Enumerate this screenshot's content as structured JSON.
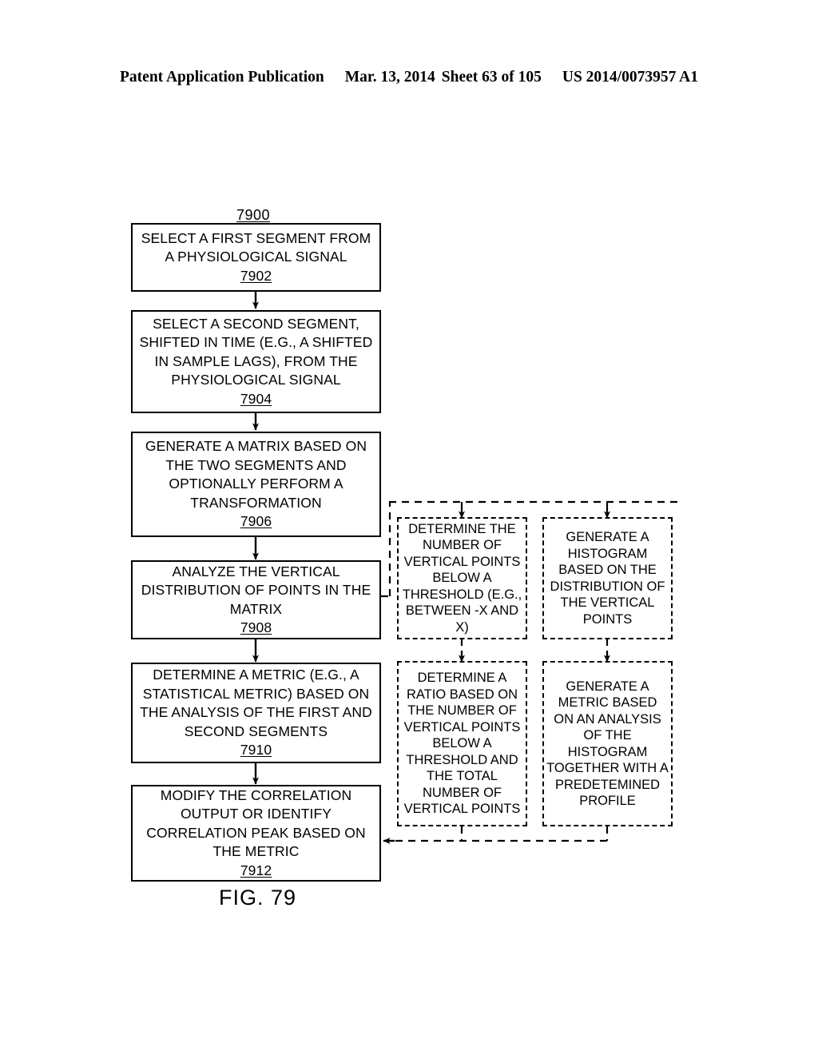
{
  "header": {
    "publication": "Patent Application Publication",
    "date": "Mar. 13, 2014",
    "sheet": "Sheet 63 of 105",
    "docnum": "US 2014/0073957 A1"
  },
  "figure": {
    "caption": "FIG. 79",
    "diagram_ref": "7900"
  },
  "flow_steps": [
    {
      "id": "7902",
      "text": "SELECT A FIRST SEGMENT FROM A PHYSIOLOGICAL SIGNAL",
      "ref": "7902"
    },
    {
      "id": "7904",
      "text": "SELECT A SECOND SEGMENT, SHIFTED IN TIME (E.G., A SHIFTED IN SAMPLE LAGS), FROM THE PHYSIOLOGICAL SIGNAL",
      "ref": "7904"
    },
    {
      "id": "7906",
      "text": "GENERATE A MATRIX BASED ON THE TWO SEGMENTS AND OPTIONALLY PERFORM A TRANSFORMATION",
      "ref": "7906"
    },
    {
      "id": "7908",
      "text": "ANALYZE THE VERTICAL DISTRIBUTION OF POINTS IN THE MATRIX",
      "ref": "7908"
    },
    {
      "id": "7910",
      "text": "DETERMINE A METRIC (E.G., A STATISTICAL METRIC) BASED ON THE ANALYSIS OF THE FIRST AND SECOND SEGMENTS",
      "ref": "7910"
    },
    {
      "id": "7912",
      "text": "MODIFY THE CORRELATION OUTPUT OR IDENTIFY CORRELATION PEAK BASED ON THE METRIC",
      "ref": "7912"
    }
  ],
  "optional_steps": [
    {
      "id": "opt-threshold-count",
      "text": "DETERMINE THE NUMBER OF VERTICAL POINTS BELOW A THRESHOLD (E.G., BETWEEN -X AND X)"
    },
    {
      "id": "opt-histogram",
      "text": "GENERATE A HISTOGRAM BASED ON THE DISTRIBUTION OF THE VERTICAL POINTS"
    },
    {
      "id": "opt-ratio",
      "text": "DETERMINE A RATIO BASED ON THE NUMBER OF VERTICAL POINTS BELOW A THRESHOLD AND THE TOTAL NUMBER OF VERTICAL POINTS"
    },
    {
      "id": "opt-profile-metric",
      "text": "GENERATE A METRIC BASED ON AN ANALYSIS OF THE HISTOGRAM TOGETHER WITH A PREDETEMINED PROFILE"
    }
  ],
  "colors": {
    "ink": "#000000",
    "paper": "#ffffff"
  }
}
